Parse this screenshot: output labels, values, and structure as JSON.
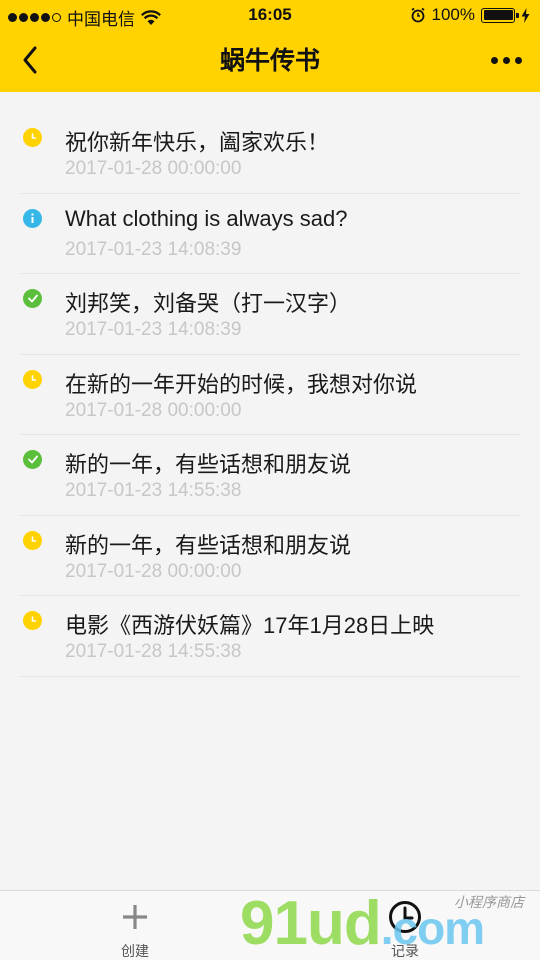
{
  "status_bar": {
    "carrier": "中国电信",
    "time": "16:05",
    "battery": "100%"
  },
  "nav": {
    "title": "蜗牛传书"
  },
  "items": [
    {
      "title": "祝你新年快乐，阖家欢乐！",
      "time": "2017-01-28 00:00:00",
      "status": "pending-clock",
      "color": "#ffd200"
    },
    {
      "title": "What clothing is always sad?",
      "time": "2017-01-23 14:08:39",
      "status": "info",
      "color": "#35b8e8"
    },
    {
      "title": "刘邦笑，刘备哭（打一汉字）",
      "time": "2017-01-23 14:08:39",
      "status": "done-check",
      "color": "#5bbf3c"
    },
    {
      "title": "在新的一年开始的时候，我想对你说",
      "time": "2017-01-28 00:00:00",
      "status": "pending-clock",
      "color": "#ffd200"
    },
    {
      "title": "新的一年，有些话想和朋友说",
      "time": "2017-01-23 14:55:38",
      "status": "done-check",
      "color": "#5bbf3c"
    },
    {
      "title": "新的一年，有些话想和朋友说",
      "time": "2017-01-28 00:00:00",
      "status": "pending-clock",
      "color": "#ffd200"
    },
    {
      "title": "电影《西游伏妖篇》17年1月28日上映",
      "time": "2017-01-28 14:55:38",
      "status": "pending-clock",
      "color": "#ffd200"
    }
  ],
  "tabs": {
    "create": "创建",
    "record": "记录"
  },
  "watermark": {
    "brand": "91ud",
    "suffix": ".com",
    "tagline": "小程序商店"
  },
  "colors": {
    "accent": "#ffd200",
    "info": "#35b8e8",
    "success": "#5bbf3c"
  }
}
